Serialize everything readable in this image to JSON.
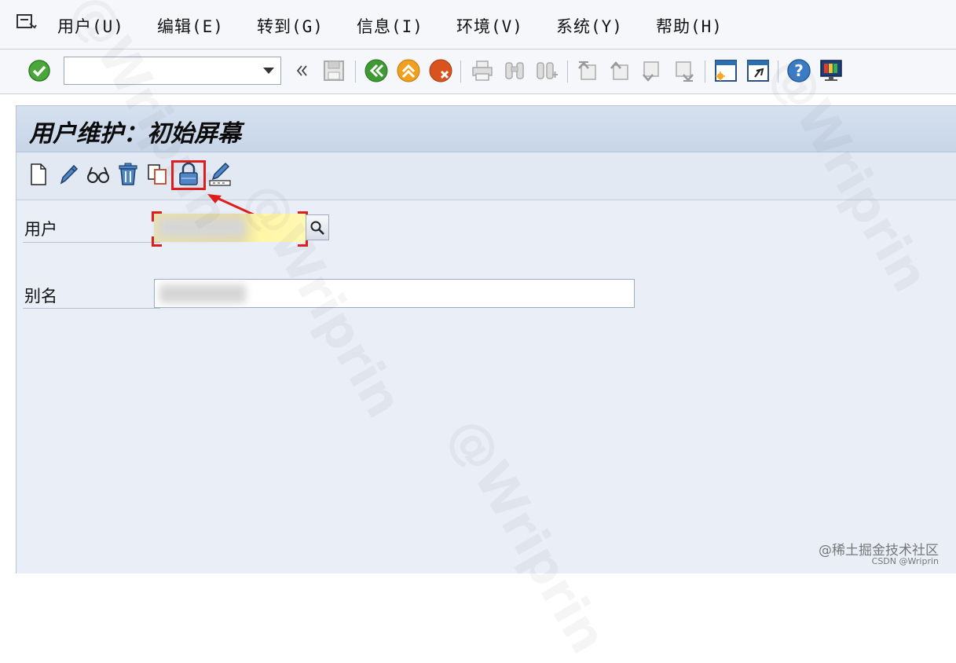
{
  "menubar": {
    "items": [
      {
        "label": "用户",
        "key": "(U)"
      },
      {
        "label": "编辑",
        "key": "(E)"
      },
      {
        "label": "转到",
        "key": "(G)"
      },
      {
        "label": "信息",
        "key": "(I)"
      },
      {
        "label": "环境",
        "key": "(V)"
      },
      {
        "label": "系统",
        "key": "(Y)"
      },
      {
        "label": "帮助",
        "key": "(H)"
      }
    ]
  },
  "toolbar": {
    "command_value": "",
    "icons": [
      "enter-icon",
      "command-dropdown",
      "collapse-icon",
      "save-icon",
      "back-icon",
      "exit-icon",
      "cancel-icon",
      "print-icon",
      "find-icon",
      "find-next-icon",
      "first-page-icon",
      "previous-page-icon",
      "next-page-icon",
      "last-page-icon",
      "create-session-icon",
      "shortcut-icon",
      "help-icon",
      "customize-layout-icon"
    ]
  },
  "screen": {
    "title": "用户维护：初始屏幕",
    "app_toolbar_icons": [
      "create-icon",
      "change-icon",
      "display-icon",
      "delete-icon",
      "copy-icon",
      "lock-icon",
      "change-documents-icon"
    ],
    "highlighted_icon": "lock-icon"
  },
  "form": {
    "user_label": "用户",
    "user_value": "",
    "alias_label": "别名",
    "alias_value": ""
  },
  "colors": {
    "highlight": "#e01d1d",
    "title_bar": "#c7d5e8",
    "required_field": "#fff6a6"
  },
  "watermark": {
    "text": "@Wriprin"
  },
  "credits": {
    "line1": "@稀土掘金技术社区",
    "line2": "CSDN @Wriprin"
  }
}
